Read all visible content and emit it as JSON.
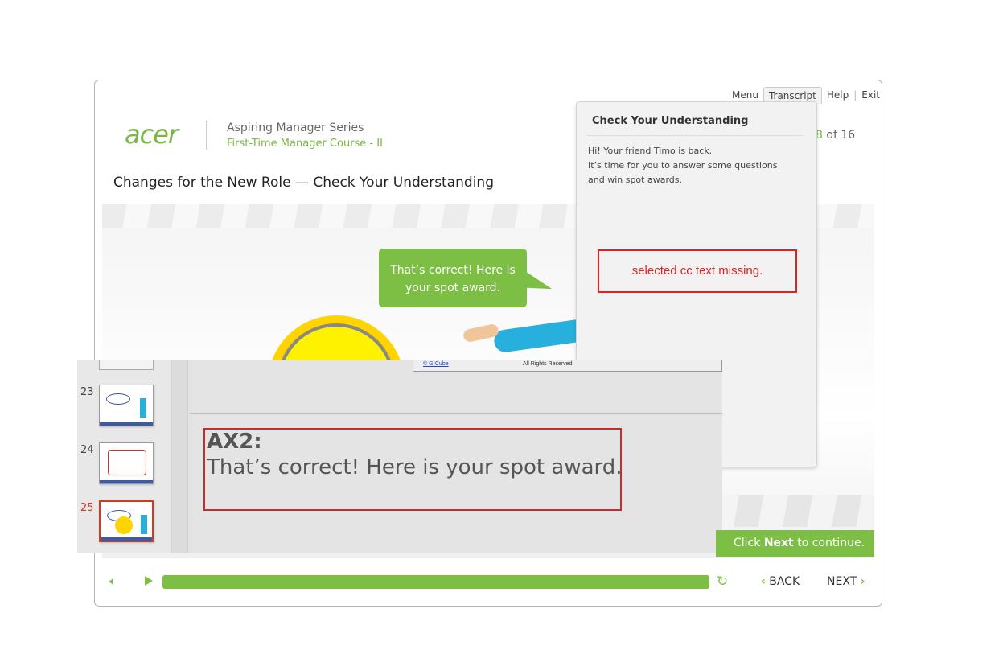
{
  "topnav": {
    "menu": "Menu",
    "transcript": "Transcript",
    "help": "Help",
    "exit": "Exit"
  },
  "header": {
    "logo": "acer",
    "series": "Aspiring Manager Series",
    "course": "First-Time Manager Course - II",
    "page_current": "8",
    "page_of": " of 16"
  },
  "slide": {
    "title": "Changes for the New Role — Check Your Understanding",
    "bubble_text": "That’s correct! Here is your spot award."
  },
  "transcript": {
    "title": "Check Your Understanding",
    "lines": [
      "Hi! Your friend Timo is back.",
      "It’s time for you to answer some questions",
      "and win spot awards."
    ],
    "missing_notice": "selected cc text missing."
  },
  "thumbnails": [
    {
      "number": "23",
      "active": false
    },
    {
      "number": "24",
      "active": false
    },
    {
      "number": "25",
      "active": true
    }
  ],
  "footer_strip": {
    "link": "© G-Cube",
    "rights": "All Rights Reserved"
  },
  "note": {
    "label": "AX2:",
    "text": "That’s correct! Here is your spot award."
  },
  "continue": {
    "prefix": "Click ",
    "bold": "Next",
    "suffix": " to continue."
  },
  "controls": {
    "progress": 1.0,
    "back": "BACK",
    "next": "NEXT",
    "colors": {
      "accent": "#7cbf44",
      "active": "#d23b1c",
      "error": "#dd2222"
    }
  }
}
